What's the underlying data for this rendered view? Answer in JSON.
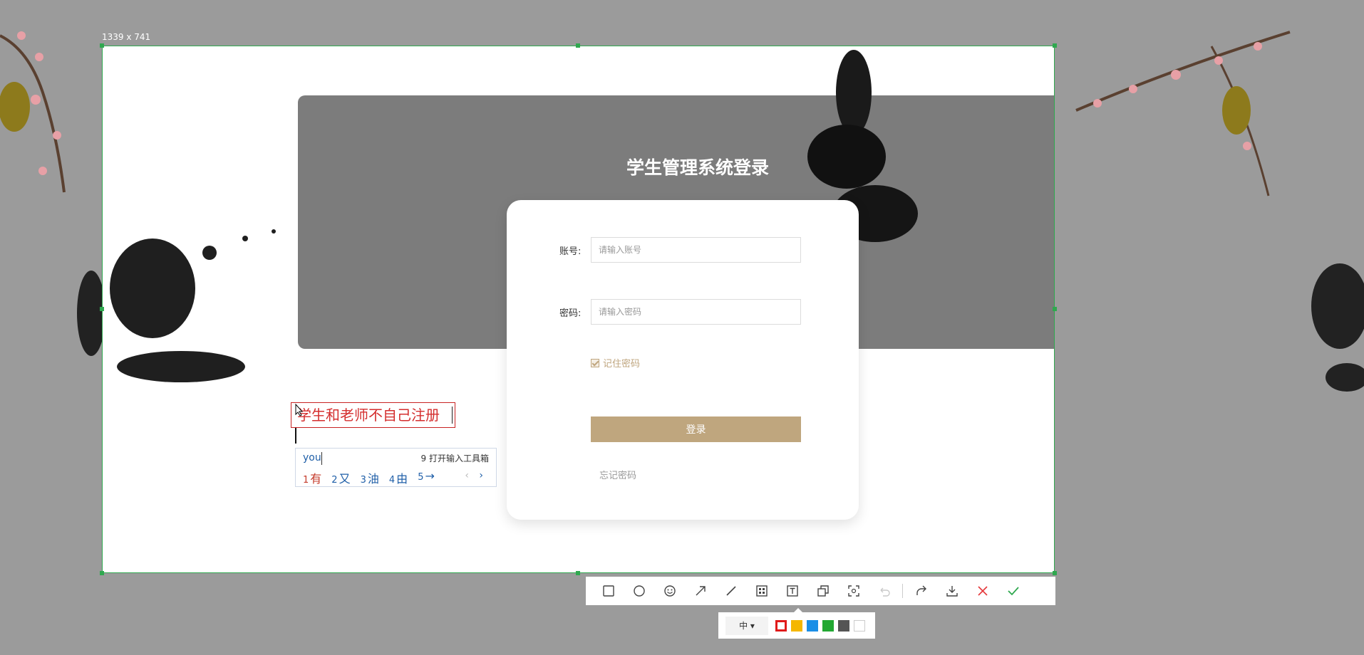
{
  "selection": {
    "size_label": "1339 x 741"
  },
  "login": {
    "title": "学生管理系统登录",
    "account_label": "账号:",
    "account_placeholder": "请输入账号",
    "password_label": "密码:",
    "password_placeholder": "请输入密码",
    "remember_label": "记住密码",
    "login_button": "登录",
    "forgot_link": "忘记密码"
  },
  "annotation": {
    "text": "学生和老师不自己注册"
  },
  "ime": {
    "input": "you",
    "toolbox": "9 打开输入工具箱",
    "candidates": [
      {
        "num": "1",
        "text": "有"
      },
      {
        "num": "2",
        "text": "又"
      },
      {
        "num": "3",
        "text": "油"
      },
      {
        "num": "4",
        "text": "由"
      },
      {
        "num": "5",
        "text": "→"
      }
    ],
    "prev": "‹",
    "next": "›"
  },
  "subbar": {
    "font_size": "中 ▾"
  },
  "colors": {
    "selection_border": "#2fa84f",
    "annotation_red": "#d42d2d",
    "login_button": "#bfa67e",
    "swatches": [
      "#e01a1a",
      "#f5b700",
      "#1b8ee6",
      "#23a833",
      "#555555",
      "#ffffff"
    ]
  }
}
